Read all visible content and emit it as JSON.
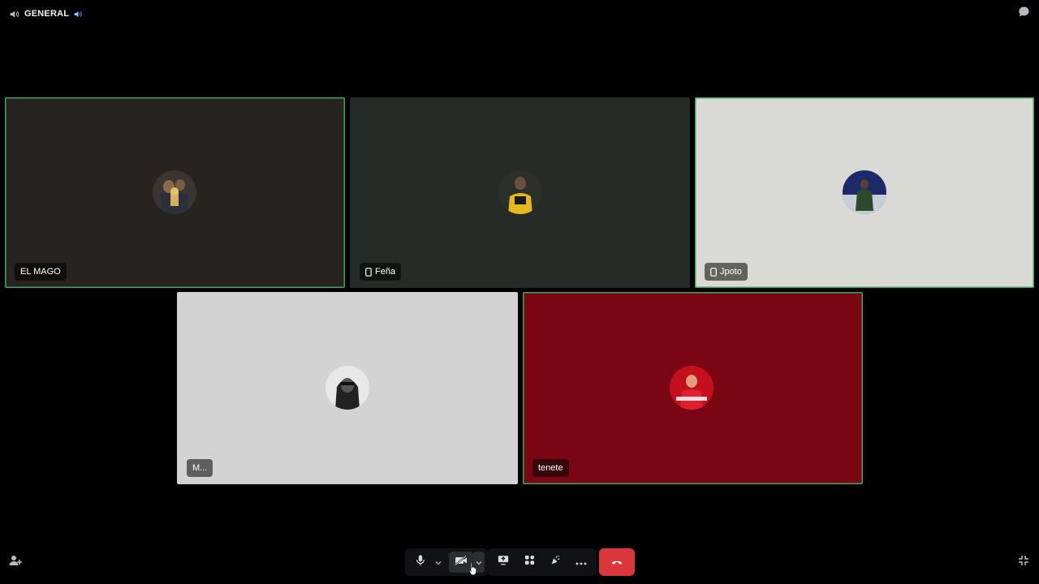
{
  "channel": {
    "name": "GENERAL"
  },
  "participants": [
    {
      "name": "EL MAGO",
      "speaking": true,
      "bg": "#262321"
    },
    {
      "name": "Feña",
      "speaking": false,
      "bg": "#272b27",
      "mobile": true
    },
    {
      "name": "Jpoto",
      "speaking": true,
      "bg": "#d9d9d5",
      "mobile": true
    },
    {
      "name": "M...",
      "speaking": false,
      "bg": "#d3d3d3"
    },
    {
      "name": "tenete",
      "speaking": true,
      "bg": "#7b0613"
    }
  ],
  "controls": {
    "icons": [
      "microphone-icon",
      "chevron-down-icon",
      "camera-off-icon",
      "chevron-down-icon",
      "screen-share-icon",
      "activities-icon",
      "soundboard-icon",
      "more-icon",
      "hang-up-icon"
    ]
  },
  "colors": {
    "speaking_ring": "#3ba55d",
    "hangup": "#da373c",
    "background": "#000000"
  }
}
